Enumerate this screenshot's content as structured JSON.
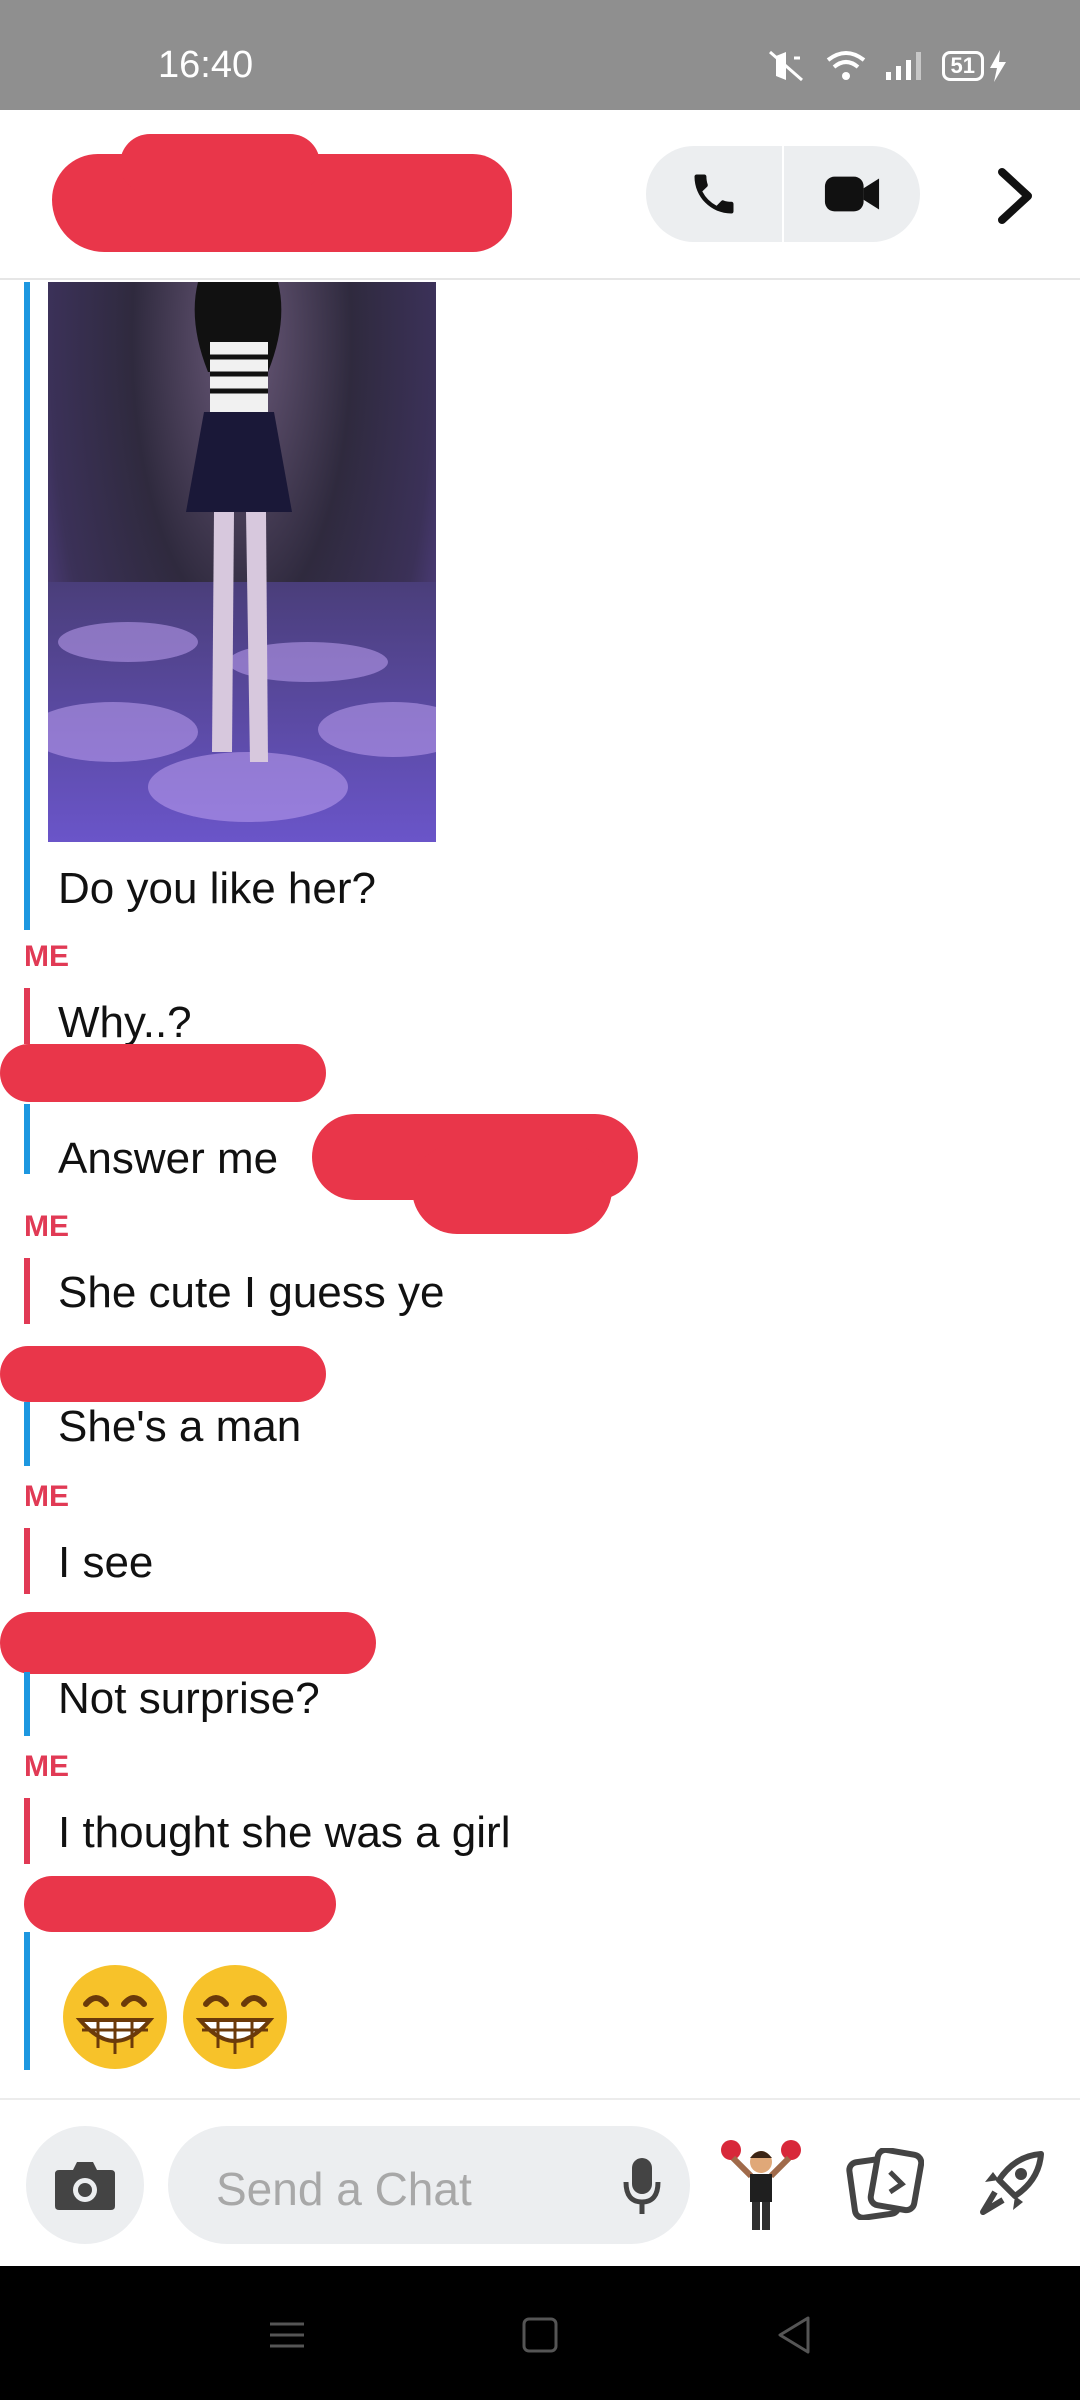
{
  "status_bar": {
    "time": "16:40",
    "battery": "51"
  },
  "header": {
    "contact_name_redacted": true
  },
  "messages": [
    {
      "sender": "other",
      "type": "image",
      "text": ""
    },
    {
      "sender": "other",
      "type": "text",
      "text": "Do you like her?"
    },
    {
      "sender": "me",
      "label": "ME",
      "text": "Why..?"
    },
    {
      "sender": "other",
      "type": "text",
      "text": "Answer me"
    },
    {
      "sender": "me",
      "label": "ME",
      "text": "She cute I guess ye"
    },
    {
      "sender": "other",
      "type": "text",
      "text": "She's a man"
    },
    {
      "sender": "me",
      "label": "ME",
      "text": "I see"
    },
    {
      "sender": "other",
      "type": "text",
      "text": "Not surprise?"
    },
    {
      "sender": "me",
      "label": "ME",
      "text": "I thought she was a girl"
    },
    {
      "sender": "other",
      "type": "emoji",
      "emoji": [
        "grinning-face",
        "grinning-face"
      ]
    }
  ],
  "composer": {
    "placeholder": "Send a Chat"
  },
  "icons": {
    "call": "phone-icon",
    "video": "video-icon",
    "forward": "chevron-right-icon",
    "camera": "camera-icon",
    "mic": "microphone-icon",
    "bitmoji": "bitmoji-icon",
    "cards": "cards-icon",
    "games": "rocket-icon"
  },
  "colors": {
    "me": "#e13a55",
    "other": "#1d97e0",
    "redaction": "#e9364a"
  }
}
